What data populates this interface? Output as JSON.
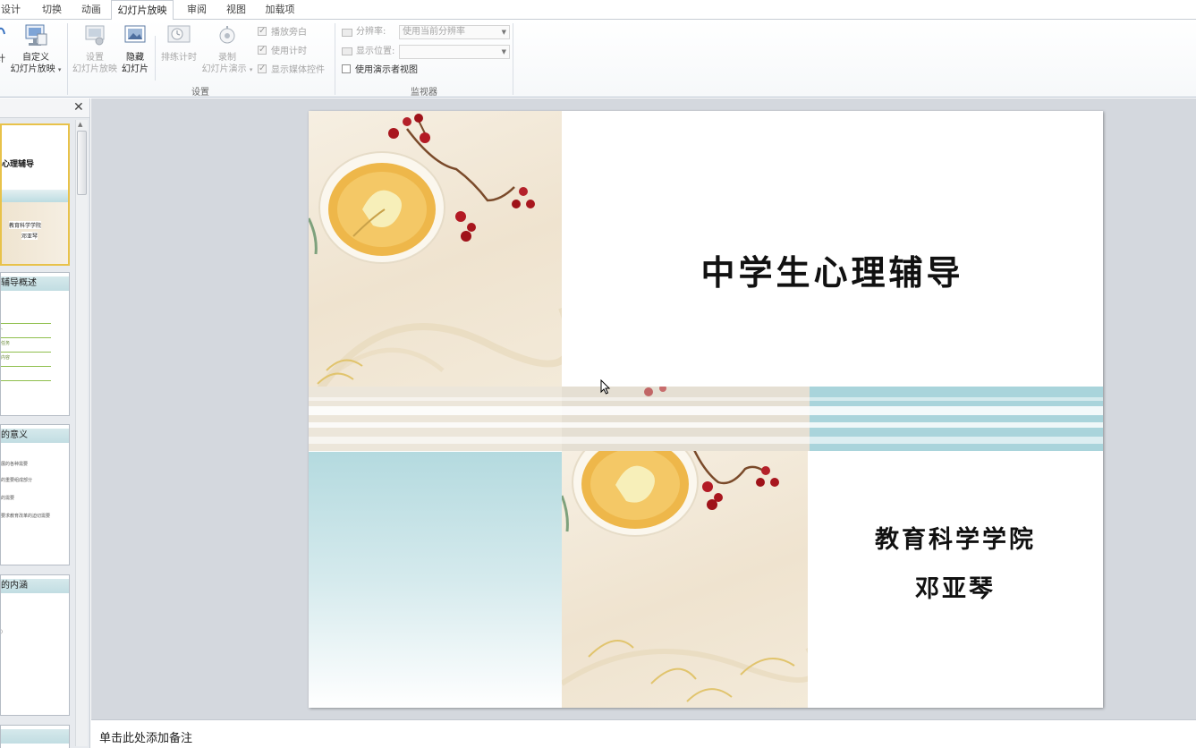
{
  "tabs": [
    {
      "label": "设计"
    },
    {
      "label": "切换"
    },
    {
      "label": "动画"
    },
    {
      "label": "幻灯片放映",
      "active": true
    },
    {
      "label": "审阅"
    },
    {
      "label": "视图"
    },
    {
      "label": "加载项"
    }
  ],
  "ribbon": {
    "cut_off_left_char_1": "计",
    "custom_show": {
      "line1": "自定义",
      "line2": "幻灯片放映"
    },
    "setup_show": {
      "line1": "设置",
      "line2": "幻灯片放映"
    },
    "hide_slide": {
      "line1": "隐藏",
      "line2": "幻灯片"
    },
    "rehearse_timings": {
      "label": "排练计时"
    },
    "record": {
      "line1": "录制",
      "line2": "幻灯片演示"
    },
    "checkboxes": {
      "play_narrations": {
        "label": "播放旁白",
        "checked": true
      },
      "use_timings": {
        "label": "使用计时",
        "checked": true
      },
      "show_media_controls": {
        "label": "显示媒体控件",
        "checked": true
      }
    },
    "setup_group_label": "设置",
    "monitors": {
      "resolution_label": "分辨率:",
      "resolution_value": "使用当前分辨率",
      "show_on_label": "显示位置:",
      "show_on_value": "",
      "presenter_view_label": "使用演示者视图",
      "presenter_view_checked": false,
      "group_label": "监视器"
    }
  },
  "slide_pane": {
    "close_glyph": "✕",
    "thumbnails": [
      {
        "title": "心理辅导",
        "line1": "教育科学学院",
        "line2": "邓亚琴",
        "selected": true
      },
      {
        "title": "辅导概述",
        "items": [
          "、",
          "任务",
          "内容"
        ]
      },
      {
        "title": "的意义",
        "items": [
          "展的各种需要",
          "的重要组成部分",
          "的需要",
          "要求教育改革的迫切需要"
        ]
      },
      {
        "title": "的内涵",
        "items": [
          "）"
        ]
      }
    ]
  },
  "slide": {
    "title": "中学生心理辅导",
    "subtitle_line1": "教育科学学院",
    "subtitle_line2": "邓亚琴"
  },
  "notes": {
    "placeholder": "单击此处添加备注"
  }
}
